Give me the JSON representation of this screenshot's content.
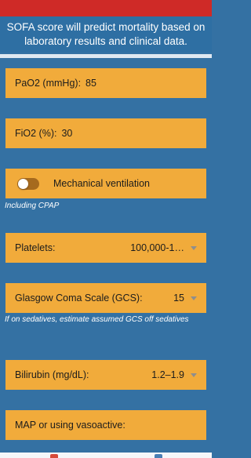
{
  "header": {
    "description": "SOFA score will predict mortality based on laboratory results and clinical data."
  },
  "fields": {
    "pao2": {
      "label": "PaO2 (mmHg):",
      "value": "85"
    },
    "fio2": {
      "label": "FiO2 (%):",
      "value": "30"
    },
    "mechanical_ventilation": {
      "label": "Mechanical ventilation",
      "enabled": false,
      "hint": "Including CPAP"
    },
    "platelets": {
      "label": "Platelets:",
      "selected": "100,000-1…"
    },
    "gcs": {
      "label": "Glasgow Coma Scale (GCS):",
      "selected": "15",
      "hint": "If on sedatives, estimate assumed GCS off sedatives"
    },
    "bilirubin": {
      "label": "Bilirubin (mg/dL):",
      "selected": "1.2–1.9"
    },
    "map": {
      "label": "MAP or using vasoactive:"
    }
  },
  "colors": {
    "status_strip": "#cf2a27",
    "header_bg": "#2e6fa3",
    "page_bg": "#3471a3",
    "card_bg": "#f1ab3b",
    "toggle_track": "#a66a1e"
  },
  "icons": [
    "dropdown-caret-icon",
    "toggle-switch"
  ]
}
